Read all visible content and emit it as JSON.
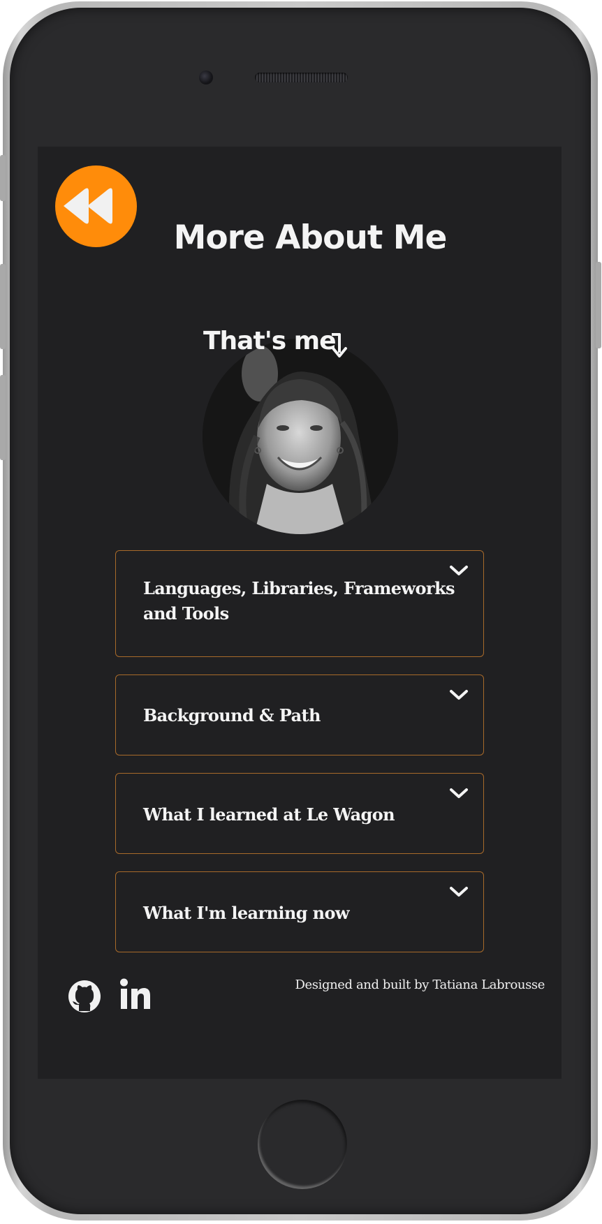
{
  "header": {
    "back_label": "",
    "title": "More About Me"
  },
  "profile": {
    "caption": "That's me"
  },
  "accordions": [
    {
      "label_line1": "Languages, Libraries, Frameworks",
      "label_line2": "and Tools"
    },
    {
      "label_line1": "Background & Path"
    },
    {
      "label_line1": "What I learned at Le Wagon"
    },
    {
      "label_line1": "What I'm learning now"
    }
  ],
  "footer": {
    "credit": "Designed and built by Tatiana Labrousse",
    "icons": [
      "github-icon",
      "linkedin-icon"
    ]
  },
  "colors": {
    "accent": "#ff8c0a",
    "screen_bg": "#202022",
    "border": "#a86a2a",
    "text": "#f4f4f4"
  }
}
